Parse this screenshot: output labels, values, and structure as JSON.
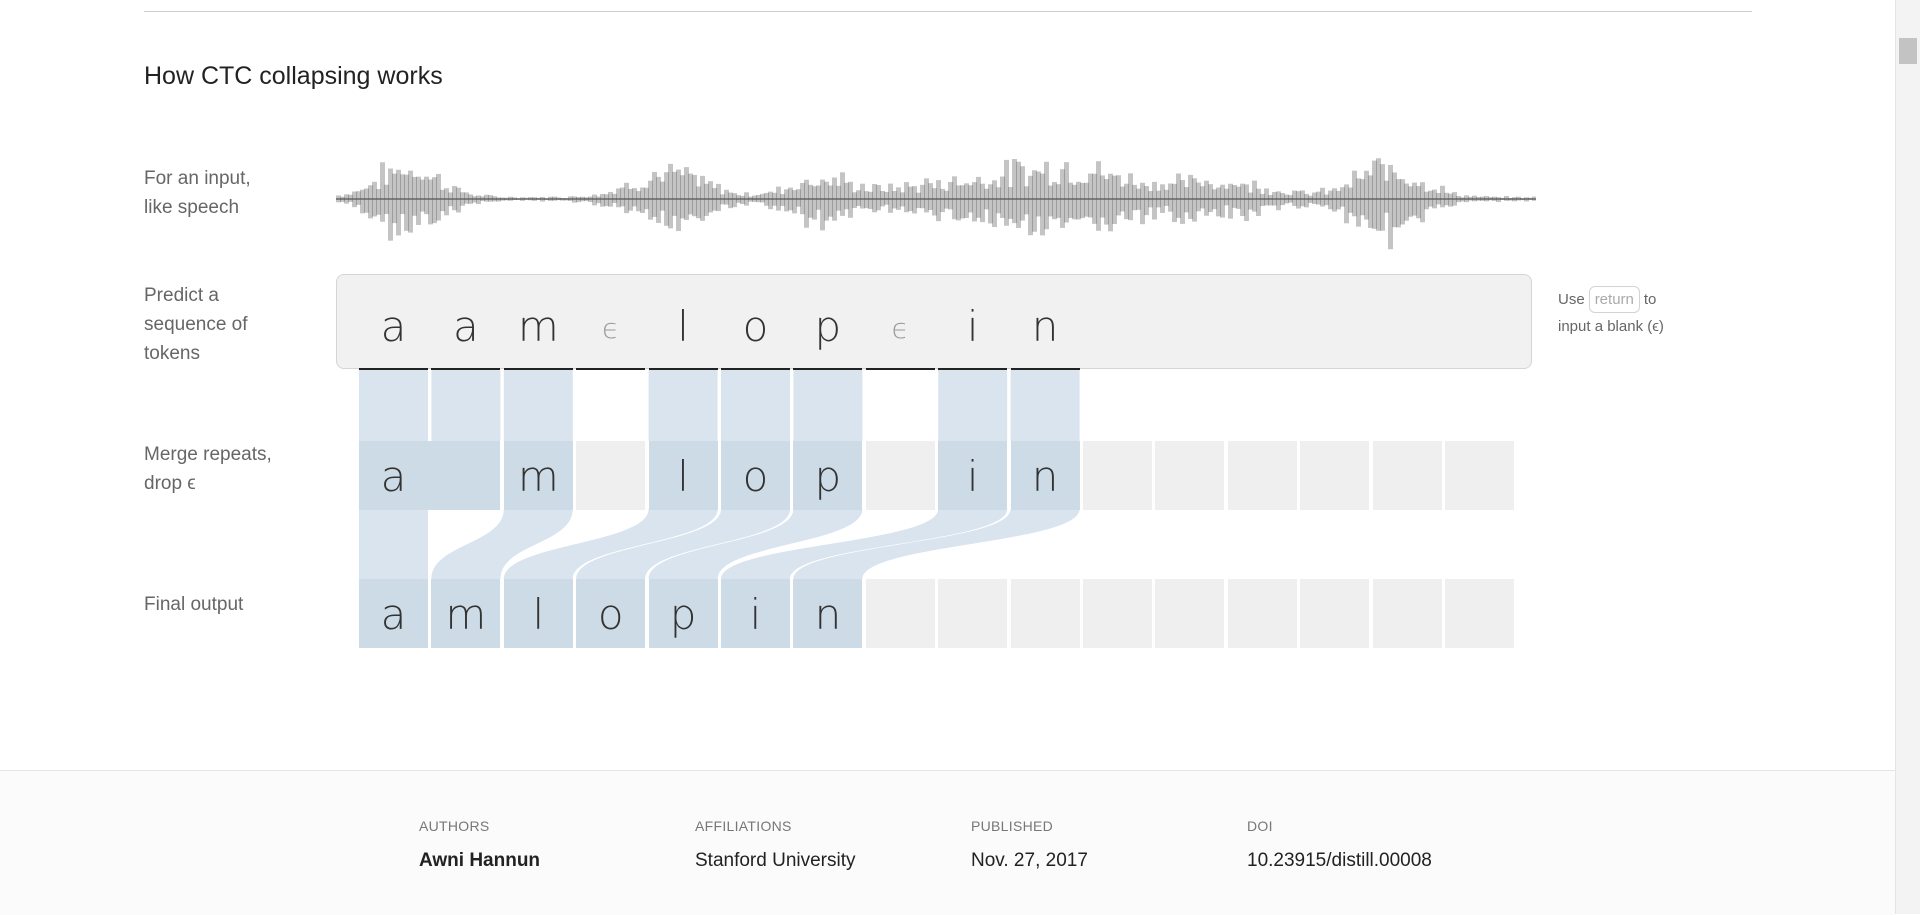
{
  "section": {
    "title": "How CTC collapsing works"
  },
  "rows": {
    "input": [
      "For an input,",
      "like speech"
    ],
    "predict": [
      "Predict a",
      "sequence of",
      "tokens"
    ],
    "merge": [
      "Merge repeats,",
      "drop ϵ"
    ],
    "final": [
      "Final output"
    ]
  },
  "hint": {
    "prefix": "Use",
    "key": "return",
    "suffix": "to",
    "line2": "input a blank (ϵ)"
  },
  "tokens": [
    "a",
    "a",
    "m",
    "ϵ",
    "l",
    "o",
    "p",
    "ϵ",
    "i",
    "n"
  ],
  "merged": [
    "a",
    "",
    "m",
    "",
    "l",
    "o",
    "p",
    "",
    "i",
    "n",
    "",
    "",
    "",
    "",
    "",
    ""
  ],
  "final_output": [
    "a",
    "m",
    "l",
    "o",
    "p",
    "i",
    "n",
    "",
    "",
    "",
    "",
    "",
    "",
    "",
    "",
    ""
  ],
  "colors": {
    "highlight": "#d9e4ee",
    "cell_empty": "#efefef",
    "wave": "#555555"
  },
  "footer": {
    "authors_label": "AUTHORS",
    "authors_value": "Awni Hannun",
    "affiliations_label": "AFFILIATIONS",
    "affiliations_value": "Stanford University",
    "published_label": "PUBLISHED",
    "published_value": "Nov. 27, 2017",
    "doi_label": "DOI",
    "doi_value": "10.23915/distill.00008"
  }
}
